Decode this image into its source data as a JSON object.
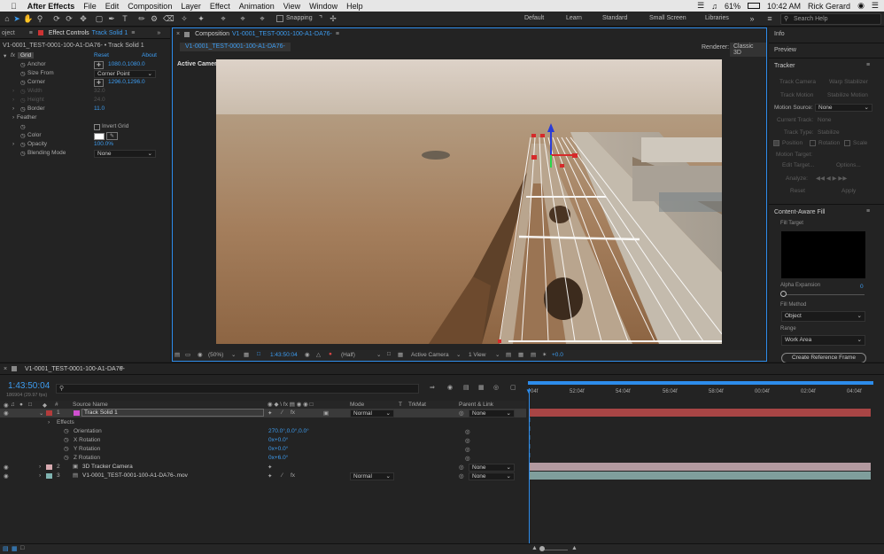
{
  "menubar": {
    "app": "After Effects",
    "items": [
      "File",
      "Edit",
      "Composition",
      "Layer",
      "Effect",
      "Animation",
      "View",
      "Window",
      "Help"
    ],
    "battery": "61%",
    "time": "10:42 AM",
    "user": "Rick Gerard"
  },
  "toolbar": {
    "snapping": "Snapping",
    "workspaces": [
      "Default",
      "Learn",
      "Standard",
      "Small Screen",
      "Libraries"
    ],
    "search_placeholder": "Search Help"
  },
  "effect_controls": {
    "tab_left": "oject",
    "tab_title": "Effect Controls",
    "tab_layer": "Track Solid 1",
    "breadcrumb": "V1-0001_TEST-0001-100-A1-DA76- • Track Solid 1",
    "effect_name": "Grid",
    "reset": "Reset",
    "about": "About",
    "anchor": {
      "label": "Anchor",
      "value": "1080.0,1080.0"
    },
    "size_from": {
      "label": "Size From",
      "value": "Corner Point"
    },
    "corner": {
      "label": "Corner",
      "value": "1296.0,1296.0"
    },
    "width": {
      "label": "Width",
      "value": "32.0"
    },
    "height": {
      "label": "Height",
      "value": "24.0"
    },
    "border": {
      "label": "Border",
      "value": "11.0"
    },
    "feather": "Feather",
    "invert_grid": "Invert Grid",
    "color": "Color",
    "opacity": {
      "label": "Opacity",
      "value": "100.0%"
    },
    "blending": {
      "label": "Blending Mode",
      "value": "None"
    }
  },
  "composition": {
    "tab_prefix": "Composition",
    "tab_name": "V1-0001_TEST-0001-100-A1-DA76-",
    "flow_tab": "V1-0001_TEST-0001-100-A1-DA76-",
    "renderer_label": "Renderer:",
    "renderer": "Classic 3D",
    "camera_label": "Active Camera",
    "bottom": {
      "zoom": "(50%)",
      "timecode": "1:43:50:04",
      "resolution": "(Half)",
      "camera": "Active Camera",
      "views": "1 View",
      "exposure": "+0.0"
    }
  },
  "right": {
    "info": "Info",
    "preview": "Preview",
    "tracker": "Tracker",
    "track_camera": "Track Camera",
    "warp_stabilizer": "Warp Stabilizer",
    "track_motion": "Track Motion",
    "stabilize_motion": "Stabilize Motion",
    "motion_source_label": "Motion Source:",
    "motion_source": "None",
    "current_track_label": "Current Track:",
    "current_track": "None",
    "track_type_label": "Track Type:",
    "track_type": "Stabilize",
    "position": "Position",
    "rotation": "Rotation",
    "scale": "Scale",
    "motion_target": "Motion Target:",
    "edit_target": "Edit Target...",
    "options": "Options...",
    "analyze": "Analyze:",
    "reset": "Reset",
    "apply": "Apply",
    "caf_title": "Content-Aware Fill",
    "fill_target": "Fill Target",
    "alpha_expansion": "Alpha Expansion",
    "alpha_value": "0",
    "fill_method": "Fill Method",
    "fill_method_value": "Object",
    "range": "Range",
    "range_value": "Work Area",
    "create_ref": "Create Reference Frame"
  },
  "timeline": {
    "tab": "V1-0001_TEST-0001-100-A1-DA76-",
    "timecode": "1:43:50:04",
    "frames": "186904 (29.97 fps)",
    "headers": {
      "num": "#",
      "source": "Source Name",
      "mode": "Mode",
      "t": "T",
      "trkmat": "TrkMat",
      "parent": "Parent & Link"
    },
    "ruler": [
      "04f",
      "52:04f",
      "54:04f",
      "56:04f",
      "58:04f",
      "00:04f",
      "02:04f",
      "04:04f"
    ],
    "layers": [
      {
        "num": "1",
        "name": "Track Solid 1",
        "mode": "Normal",
        "parent": "None",
        "color": "#b43c3c"
      },
      {
        "num": "2",
        "name": "3D Tracker Camera",
        "mode": "",
        "parent": "None",
        "color": "#d7aab0"
      },
      {
        "num": "3",
        "name": "V1-0001_TEST-0001-100-A1-DA76-.mov",
        "mode": "Normal",
        "parent": "None",
        "color": "#7fb3b0"
      }
    ],
    "effects_label": "Effects",
    "props": [
      {
        "name": "Orientation",
        "value": "270.0°,0.0°,0.0°"
      },
      {
        "name": "X Rotation",
        "value": "0x+0.0°"
      },
      {
        "name": "Y Rotation",
        "value": "0x+0.0°"
      },
      {
        "name": "Z Rotation",
        "value": "0x+6.0°"
      }
    ]
  },
  "colors": {
    "accent": "#2d8ceb",
    "layer1_bar": "#a84545",
    "layer2_bar": "#b39aa0",
    "layer3_bar": "#7f9e9c"
  }
}
